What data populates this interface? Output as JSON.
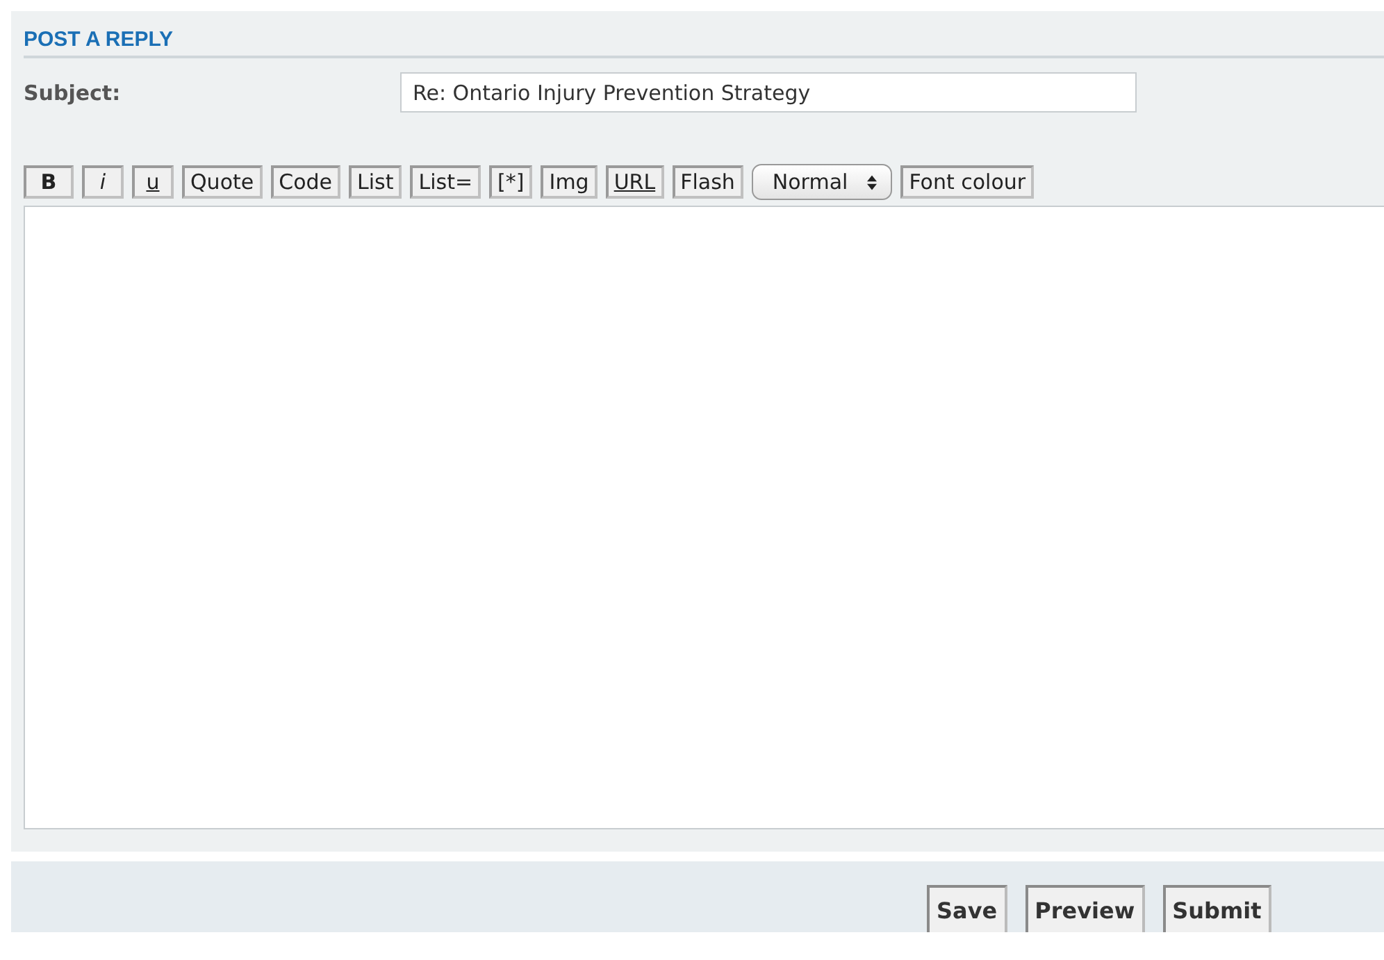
{
  "heading": "POST A REPLY",
  "subject": {
    "label": "Subject:",
    "value": "Re: Ontario Injury Prevention Strategy"
  },
  "toolbar": [
    {
      "label": "B",
      "kind": "bold"
    },
    {
      "label": "i",
      "kind": "italic"
    },
    {
      "label": "u",
      "kind": "underline"
    },
    {
      "label": "Quote",
      "kind": "plain"
    },
    {
      "label": "Code",
      "kind": "plain"
    },
    {
      "label": "List",
      "kind": "plain"
    },
    {
      "label": "List=",
      "kind": "plain"
    },
    {
      "label": "[*]",
      "kind": "plain"
    },
    {
      "label": "Img",
      "kind": "plain"
    },
    {
      "label": "URL",
      "kind": "underline"
    },
    {
      "label": "Flash",
      "kind": "plain"
    },
    {
      "label": "Normal",
      "kind": "select"
    },
    {
      "label": "Font colour",
      "kind": "plain"
    }
  ],
  "buttons": [
    "Save",
    "Preview",
    "Submit"
  ]
}
